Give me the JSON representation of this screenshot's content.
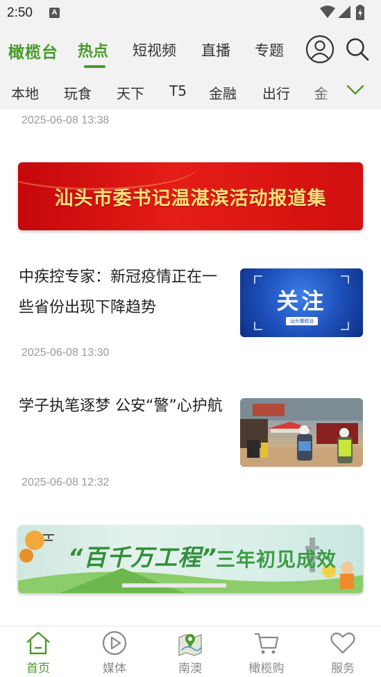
{
  "status_bar": {
    "time": "2:50",
    "notification_letter": "A"
  },
  "top_nav": {
    "brand": "橄榄台",
    "tabs": [
      {
        "label": "热点",
        "active": true
      },
      {
        "label": "短视频",
        "active": false
      },
      {
        "label": "直播",
        "active": false
      },
      {
        "label": "专题",
        "active": false
      }
    ],
    "icons": [
      "user-icon",
      "search-icon"
    ]
  },
  "channels": {
    "items": [
      "本地",
      "玩食",
      "天下",
      "T5",
      "金融",
      "出行",
      "金"
    ],
    "more_icon": "chevron-down-icon"
  },
  "feed": {
    "top_timestamp": "2025-06-08 13:38",
    "banner1": {
      "text": "汕头市委书记温湛滨活动报道集"
    },
    "articles": [
      {
        "title": "中疾控专家：新冠疫情正在一些省份出现下降趋势",
        "thumb_text": "关注",
        "thumb_tag": "汕头橄榄台",
        "timestamp": "2025-06-08 13:30"
      },
      {
        "title": "学子执笔逐梦 公安“警”心护航",
        "timestamp": "2025-06-08 12:32"
      }
    ],
    "banner2": {
      "title": "“百千万工程”",
      "subtitle": "三年初见成效"
    }
  },
  "bottom_nav": {
    "items": [
      {
        "label": "首页",
        "icon": "home-icon",
        "active": true
      },
      {
        "label": "媒体",
        "icon": "play-icon",
        "active": false
      },
      {
        "label": "南澳",
        "icon": "map-icon",
        "active": false
      },
      {
        "label": "橄榄购",
        "icon": "cart-icon",
        "active": false
      },
      {
        "label": "服务",
        "icon": "heart-icon",
        "active": false
      }
    ]
  },
  "colors": {
    "accent": "#4a9a2c",
    "background": "#f2f2f2",
    "timestamp": "#9a9a9a"
  }
}
